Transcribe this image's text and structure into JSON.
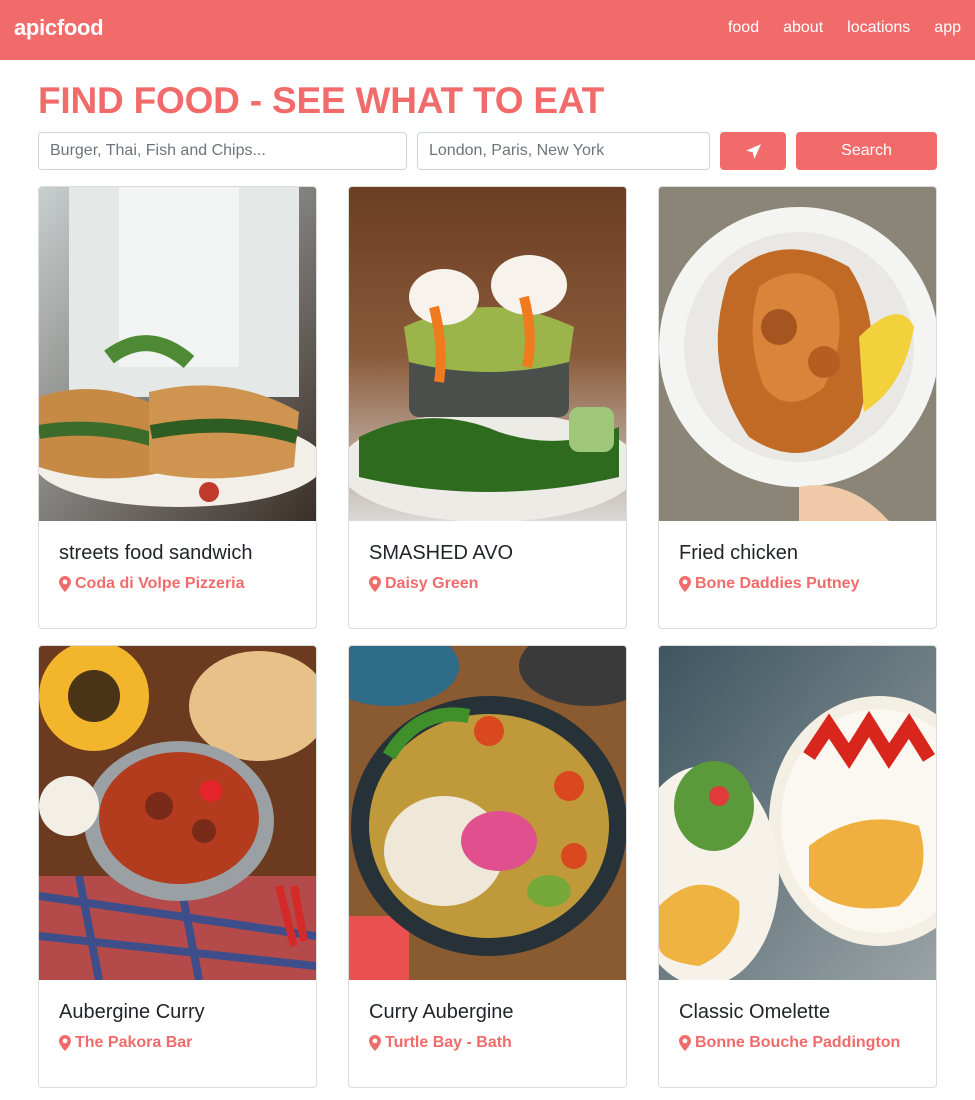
{
  "brand": "apicfood",
  "nav": [
    "food",
    "about",
    "locations",
    "app"
  ],
  "heading": "FIND FOOD - SEE WHAT TO EAT",
  "search": {
    "food_placeholder": "Burger, Thai, Fish and Chips...",
    "location_placeholder": "London, Paris, New York",
    "locate_icon": "location-arrow-icon",
    "button_label": "Search"
  },
  "colors": {
    "accent": "#f16b6b",
    "text": "#212529"
  },
  "cards": [
    {
      "title": "streets food sandwich",
      "venue": "Coda di Volpe Pizzeria",
      "image": "sandwich-photo"
    },
    {
      "title": "SMASHED AVO",
      "venue": "Daisy Green",
      "image": "smashed-avo-photo"
    },
    {
      "title": "Fried chicken",
      "venue": "Bone Daddies Putney",
      "image": "fried-chicken-photo"
    },
    {
      "title": "Aubergine Curry",
      "venue": "The Pakora Bar",
      "image": "aubergine-curry-photo"
    },
    {
      "title": "Curry Aubergine",
      "venue": "Turtle Bay - Bath",
      "image": "curry-bowl-photo"
    },
    {
      "title": "Classic Omelette",
      "venue": "Bonne Bouche Paddington",
      "image": "omelette-photo"
    }
  ]
}
